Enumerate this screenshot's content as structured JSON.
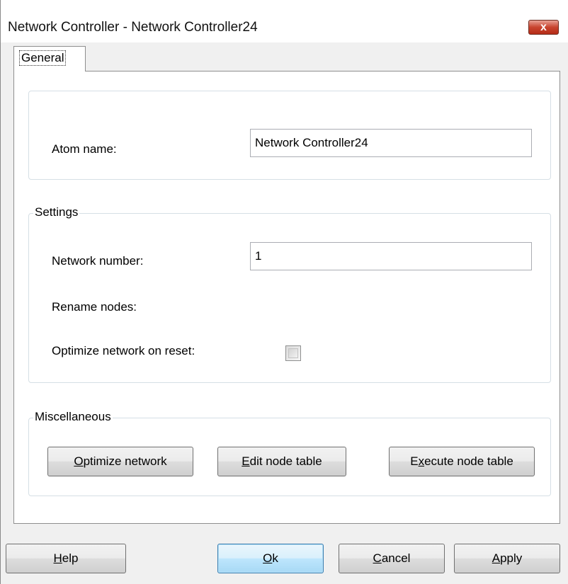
{
  "window": {
    "title": "Network Controller - Network Controller24",
    "close_label": "x"
  },
  "tabs": [
    {
      "label": "General"
    }
  ],
  "general": {
    "atom_name_label": "Atom name:",
    "atom_name_value": "Network Controller24"
  },
  "settings": {
    "legend": "Settings",
    "network_number_label": "Network number:",
    "network_number_value": "1",
    "rename_nodes_label": "Rename nodes:",
    "optimize_on_reset_label": "Optimize network on reset:",
    "optimize_on_reset_checked": false
  },
  "misc": {
    "legend": "Miscellaneous",
    "optimize_network": {
      "hotkey": "O",
      "rest": "ptimize network"
    },
    "edit_node_table": {
      "hotkey": "E",
      "rest": "dit node table"
    },
    "execute_node_table": {
      "pre": "E",
      "hotkey": "x",
      "rest": "ecute node table"
    }
  },
  "footer": {
    "help": {
      "hotkey": "H",
      "rest": "elp"
    },
    "ok": {
      "hotkey": "O",
      "rest": "k"
    },
    "cancel": {
      "hotkey": "C",
      "rest": "ancel"
    },
    "apply": {
      "hotkey": "A",
      "rest": "pply"
    }
  }
}
